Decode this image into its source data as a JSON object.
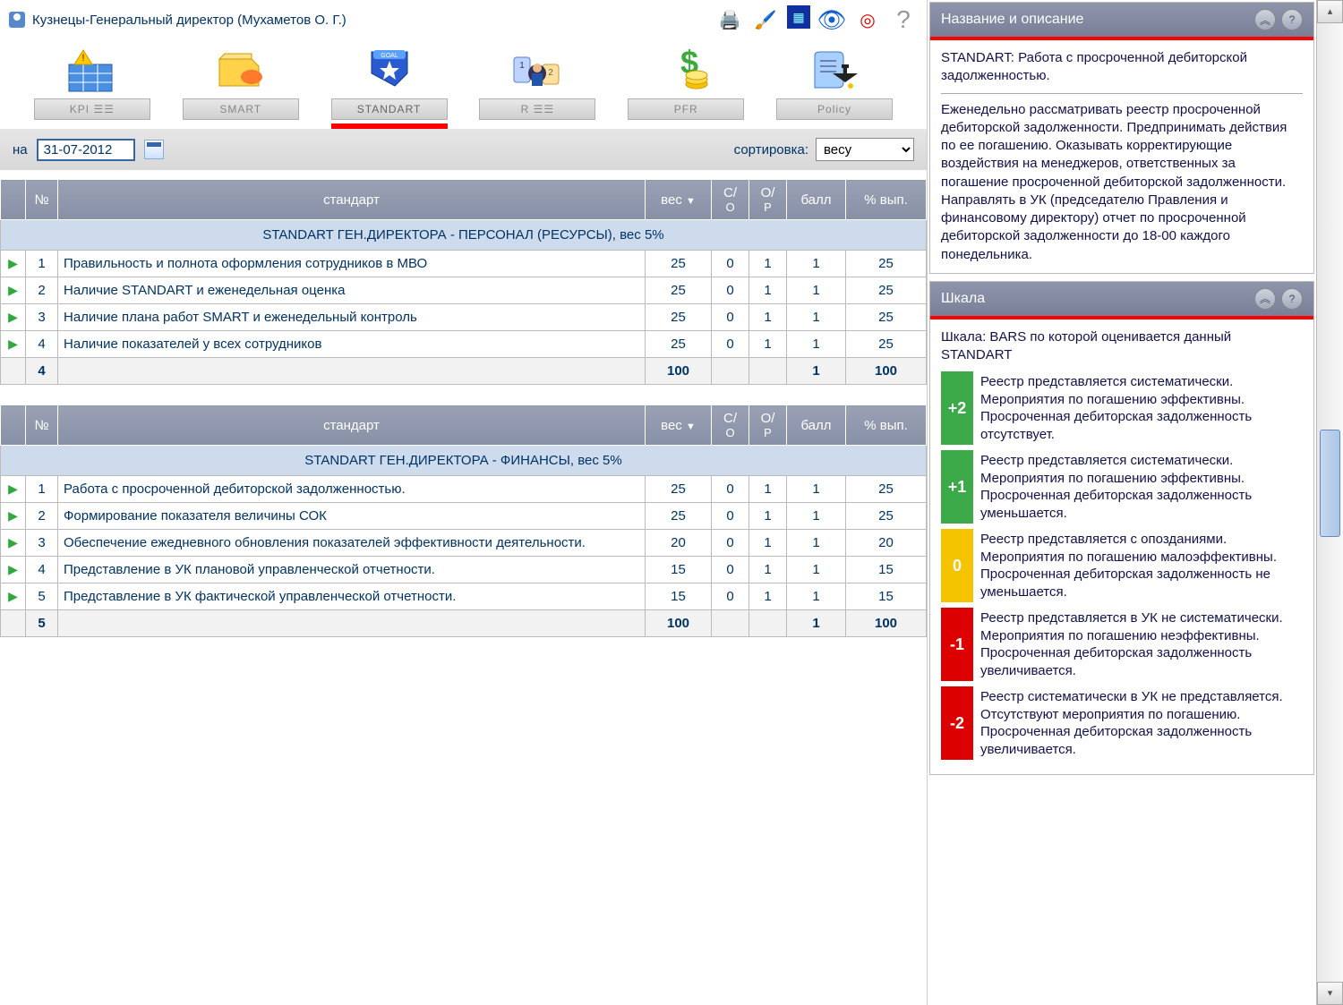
{
  "title": "Кузнецы-Генеральный директор  (Мухаметов О. Г.)",
  "toolbarIcons": [
    "print-icon",
    "brush-icon",
    "screen-icon",
    "eye-icon",
    "target-icon",
    "help-icon"
  ],
  "tabs": [
    {
      "id": "kpi",
      "label": "KPI  ☰☰"
    },
    {
      "id": "smart",
      "label": "SMART"
    },
    {
      "id": "standart",
      "label": "STANDART",
      "active": true
    },
    {
      "id": "r",
      "label": "R  ☰☰"
    },
    {
      "id": "pfr",
      "label": "PFR"
    },
    {
      "id": "policy",
      "label": "Policy"
    }
  ],
  "filter": {
    "dateLabel": "на",
    "dateValue": "31-07-2012",
    "sortLabel": "сортировка:",
    "sortValue": "весу"
  },
  "columns": {
    "num": "№",
    "standard": "стандарт",
    "weight": "вес",
    "so_top": "С/",
    "so_bot": "О",
    "op_top": "О/",
    "op_bot": "Р",
    "score": "балл",
    "pct": "% вып."
  },
  "group1": {
    "title": "STANDART ГЕН.ДИРЕКТОРА - ПЕРСОНАЛ (РЕСУРСЫ), вес 5%",
    "rows": [
      {
        "n": "1",
        "name": "Правильность и полнота оформления сотрудников в МВО",
        "w": "25",
        "so": "0",
        "op": "1",
        "b": "1",
        "p": "25"
      },
      {
        "n": "2",
        "name": "Наличие STANDART и еженедельная оценка",
        "w": "25",
        "so": "0",
        "op": "1",
        "b": "1",
        "p": "25"
      },
      {
        "n": "3",
        "name": "Наличие плана работ SMART и еженедельный контроль",
        "w": "25",
        "so": "0",
        "op": "1",
        "b": "1",
        "p": "25"
      },
      {
        "n": "4",
        "name": "Наличие показателей у всех сотрудников",
        "w": "25",
        "so": "0",
        "op": "1",
        "b": "1",
        "p": "25"
      }
    ],
    "sum": {
      "count": "4",
      "w": "100",
      "b": "1",
      "p": "100"
    }
  },
  "group2": {
    "title": "STANDART ГЕН.ДИРЕКТОРА - ФИНАНСЫ, вес 5%",
    "rows": [
      {
        "n": "1",
        "name": "Работа с просроченной дебиторской задолженностью.",
        "w": "25",
        "so": "0",
        "op": "1",
        "b": "1",
        "p": "25"
      },
      {
        "n": "2",
        "name": "Формирование показателя величины СОК",
        "w": "25",
        "so": "0",
        "op": "1",
        "b": "1",
        "p": "25"
      },
      {
        "n": "3",
        "name": "Обеспечение ежедневного обновления показателей эффективности деятельности.",
        "w": "20",
        "so": "0",
        "op": "1",
        "b": "1",
        "p": "20"
      },
      {
        "n": "4",
        "name": "Представление в УК плановой управленческой отчетности.",
        "w": "15",
        "so": "0",
        "sored": true,
        "op": "1",
        "b": "1",
        "p": "15"
      },
      {
        "n": "5",
        "name": "Представление в УК фактической управленческой отчетности.",
        "w": "15",
        "so": "0",
        "sored": true,
        "op": "1",
        "b": "1",
        "p": "15"
      }
    ],
    "sum": {
      "count": "5",
      "w": "100",
      "b": "1",
      "p": "100"
    }
  },
  "panel1": {
    "header": "Название и описание",
    "title": "STANDART: Работа с просроченной дебиторской задолженностью.",
    "body": "Еженедельно рассматривать реестр просроченной дебиторской задолженности. Предпринимать действия по ее погашению. Оказывать корректирующие воздействия на менеджеров, ответственных за погашение просроченной дебиторской задолженности. Направлять в УК (председателю Правления и финансовому директору) отчет по просроченной дебиторской задолженности до 18-00 каждого понедельника."
  },
  "panel2": {
    "header": "Шкала",
    "intro": "Шкала: BARS по которой оценивается данный STANDART",
    "scale": [
      {
        "v": "+2",
        "cls": "g2",
        "t": "Реестр представляется систематически. Мероприятия по погашению эффективны. Просроченная дебиторская задолженность отсутствует."
      },
      {
        "v": "+1",
        "cls": "g1",
        "t": "Реестр представляется систематически. Мероприятия по погашению эффективны. Просроченная дебиторская задолженность уменьшается."
      },
      {
        "v": "0",
        "cls": "y0",
        "t": "Реестр представляется с опозданиями. Мероприятия по погашению малоэффективны. Просроченная дебиторская задолженность не уменьшается."
      },
      {
        "v": "-1",
        "cls": "rN1",
        "t": "Реестр представляется в УК не систематически. Мероприятия по погашению неэффективны. Просроченная дебиторская задолженность увеличивается."
      },
      {
        "v": "-2",
        "cls": "rN2",
        "t": "Реестр систематически в УК не представляется. Отсутствуют мероприятия по погашению. Просроченная дебиторская задолженность увеличивается."
      }
    ]
  }
}
